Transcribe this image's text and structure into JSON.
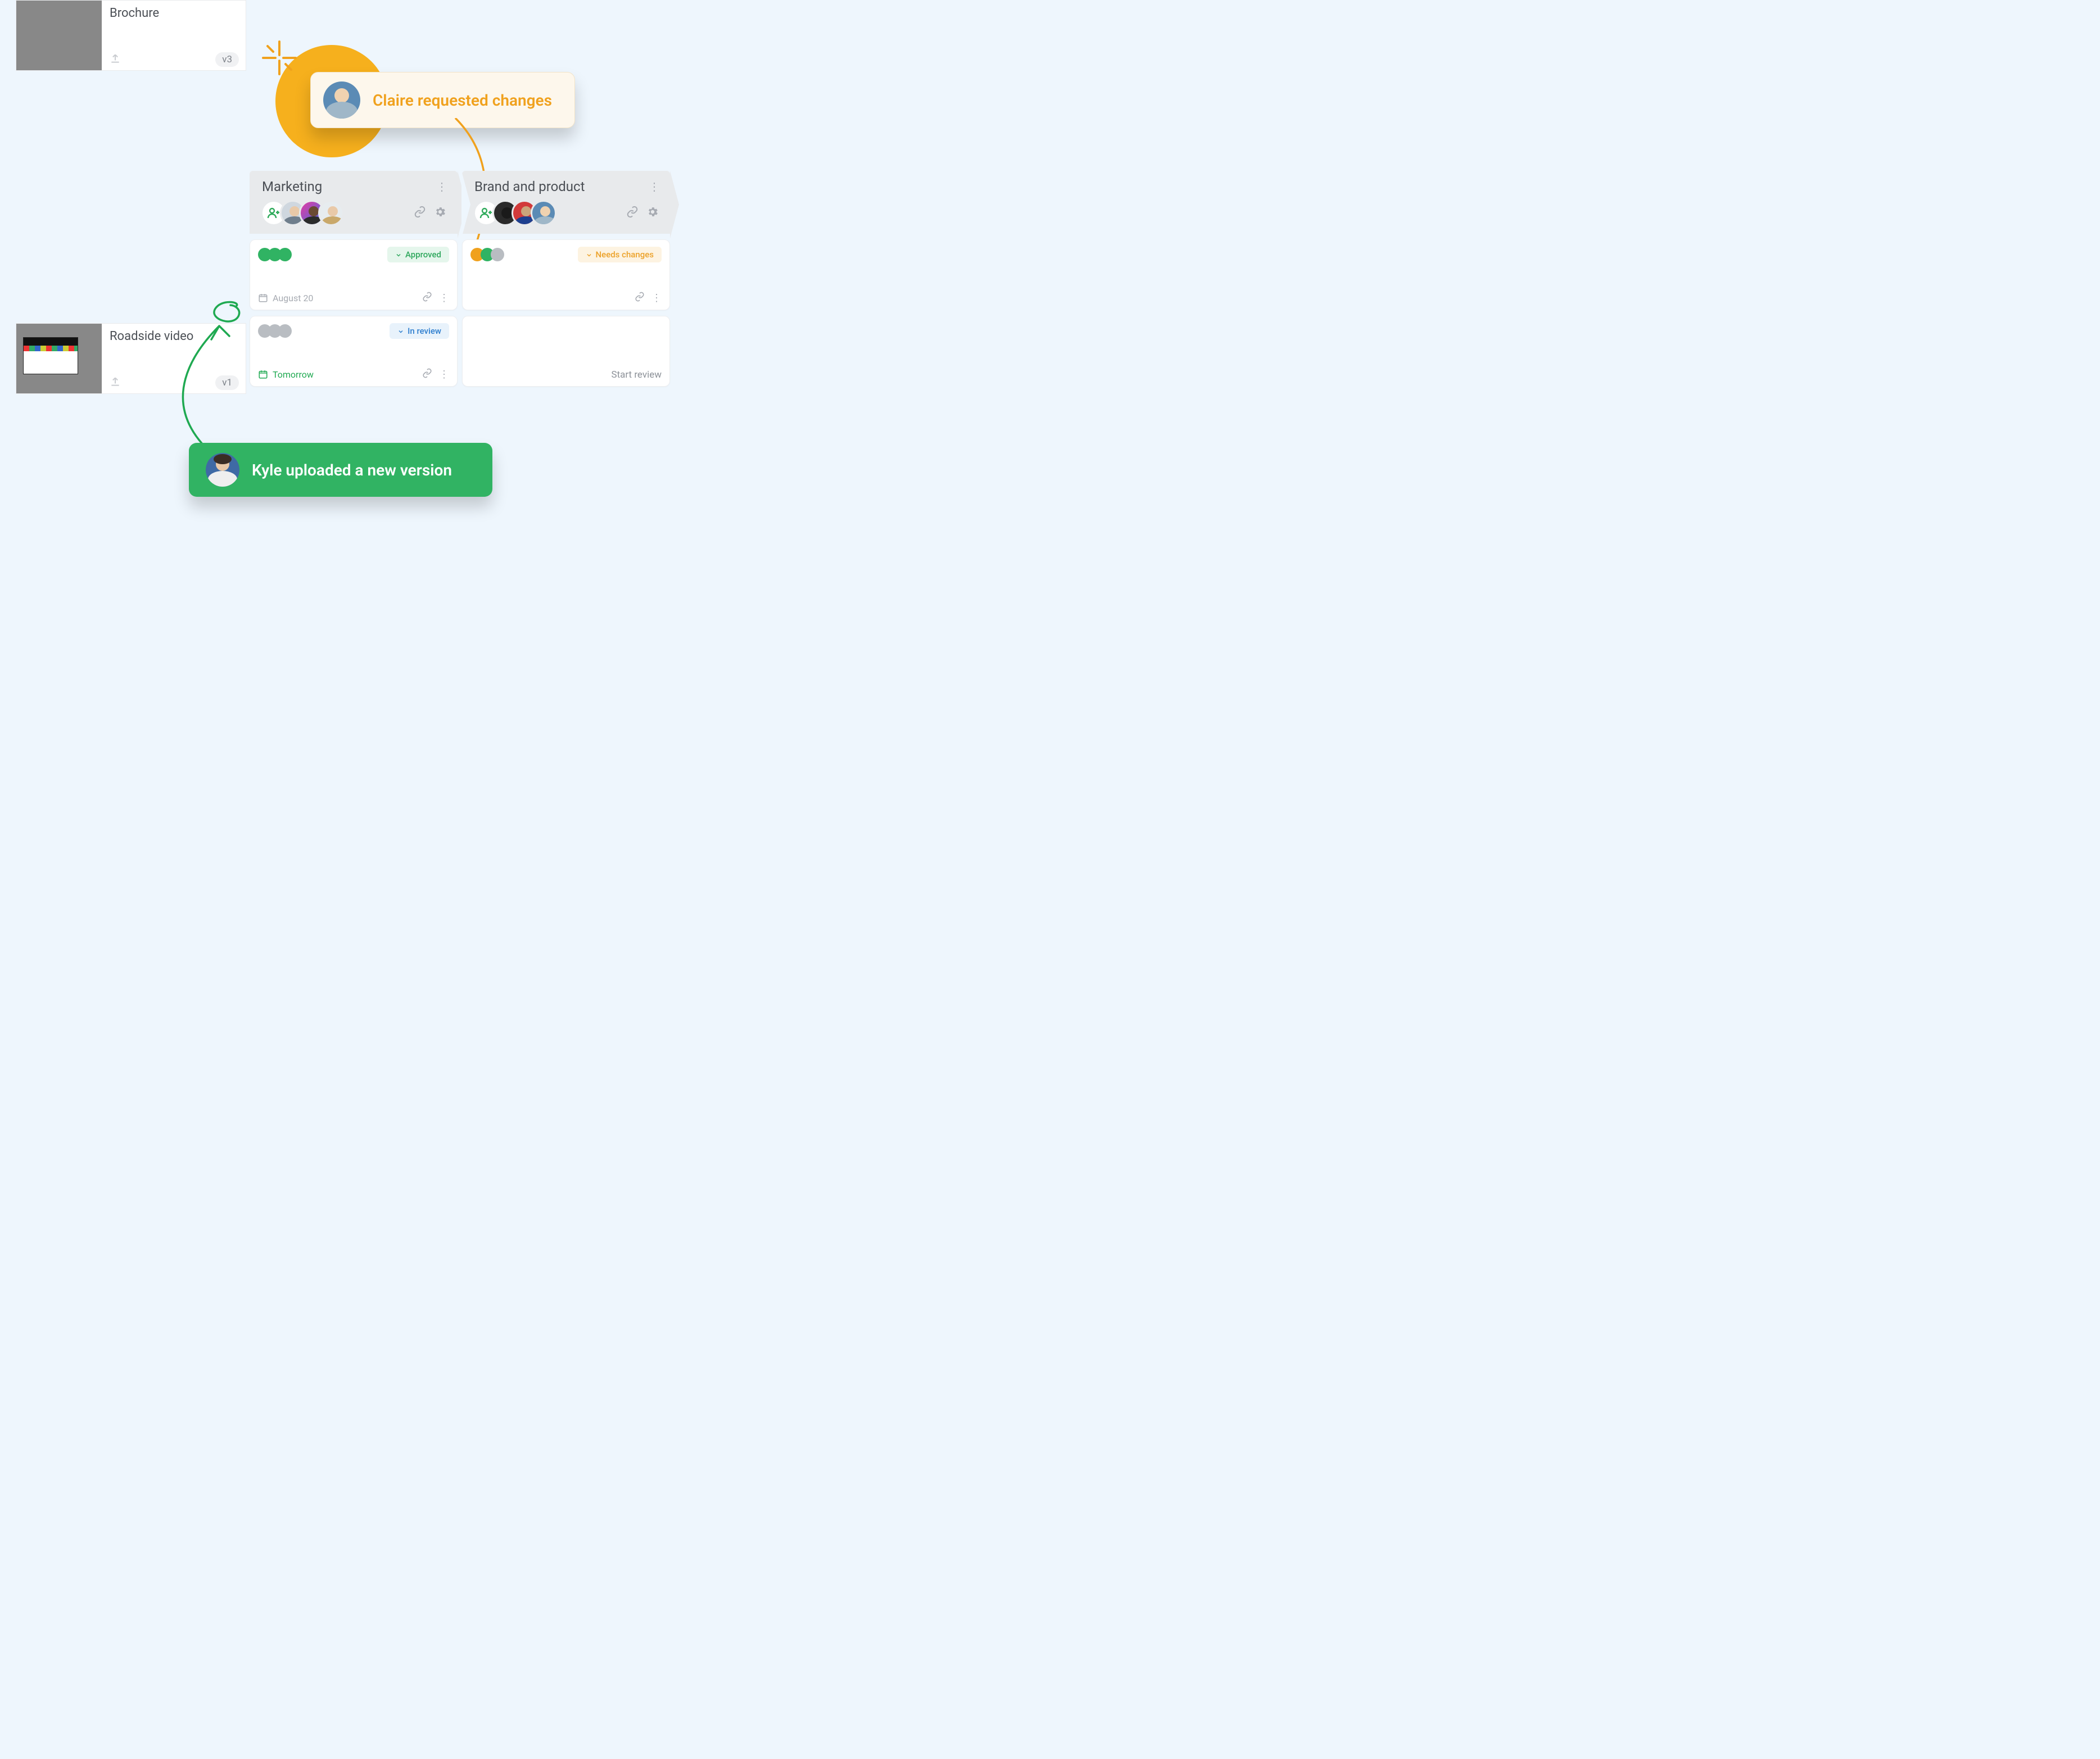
{
  "notifications": {
    "requested_changes": "Claire requested changes",
    "new_version": "Kyle uploaded a new version"
  },
  "assets": [
    {
      "title": "Brochure",
      "version": "v3"
    },
    {
      "title": "Roadside video",
      "version": "v1"
    }
  ],
  "columns": {
    "marketing": {
      "title": "Marketing",
      "cards": [
        {
          "status_label": "Approved",
          "date_label": "August 20",
          "dots": [
            "#30b363",
            "#30b363",
            "#30b363"
          ]
        },
        {
          "status_label": "In review",
          "date_label": "Tomorrow",
          "dots": [
            "#b9bdc2",
            "#b9bdc2",
            "#b9bdc2"
          ]
        }
      ]
    },
    "brand": {
      "title": "Brand and product",
      "cards": [
        {
          "status_label": "Needs changes",
          "dots": [
            "#f0a11d",
            "#30b363",
            "#b9bdc2"
          ]
        },
        {
          "start_label": "Start review"
        }
      ]
    }
  }
}
